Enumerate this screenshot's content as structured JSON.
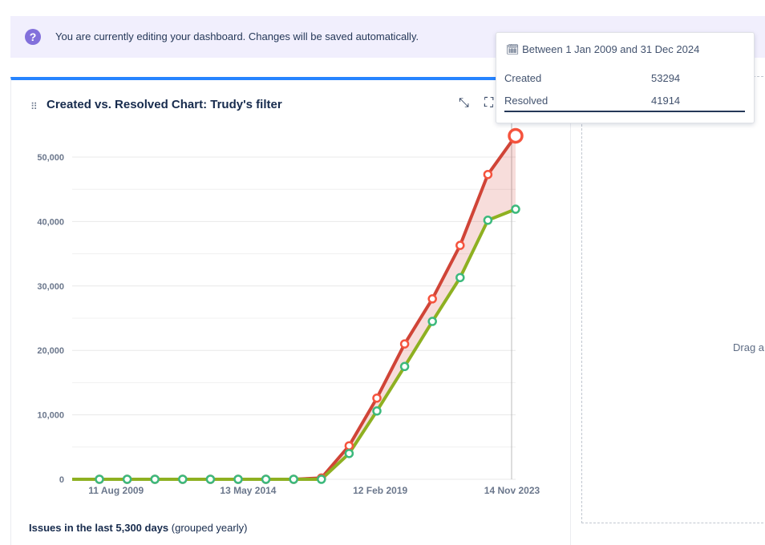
{
  "banner": {
    "message": "You are currently editing your dashboard. Changes will be saved automatically."
  },
  "gadget": {
    "title": "Created vs. Resolved Chart: Trudy's filter",
    "footer_bold": "Issues in the last 5,300 days",
    "footer_rest": " (grouped yearly)"
  },
  "drop_zone": {
    "label": "Drag a"
  },
  "tooltip": {
    "header": "Between 1 Jan 2009 and 31 Dec 2024",
    "rows": [
      {
        "label": "Created",
        "value": "53294"
      },
      {
        "label": "Resolved",
        "value": "41914"
      }
    ]
  },
  "chart_data": {
    "type": "line",
    "x": [
      2009,
      2010,
      2011,
      2012,
      2013,
      2014,
      2015,
      2016,
      2017,
      2018,
      2019,
      2020,
      2021,
      2022,
      2023,
      2024
    ],
    "series": [
      {
        "name": "Created",
        "color": "#d04437",
        "values": [
          0,
          0,
          0,
          0,
          0,
          0,
          0,
          0,
          200,
          5200,
          12600,
          21000,
          28000,
          36300,
          47300,
          53294
        ]
      },
      {
        "name": "Resolved",
        "color": "#8eb021",
        "values": [
          0,
          0,
          0,
          0,
          0,
          0,
          0,
          0,
          0,
          4000,
          10600,
          17500,
          24500,
          31300,
          40200,
          41914
        ]
      }
    ],
    "yticks": [
      0,
      10000,
      20000,
      30000,
      40000,
      50000
    ],
    "ytick_labels": [
      "0",
      "10,000",
      "20,000",
      "30,000",
      "40,000",
      "50,000"
    ],
    "xticks": [
      {
        "at": 2009.6,
        "label": "11 Aug 2009"
      },
      {
        "at": 2014.36,
        "label": "13 May 2014"
      },
      {
        "at": 2019.12,
        "label": "12 Feb 2019"
      },
      {
        "at": 2023.87,
        "label": "14 Nov 2023"
      }
    ],
    "ylim": [
      0,
      50000
    ]
  }
}
